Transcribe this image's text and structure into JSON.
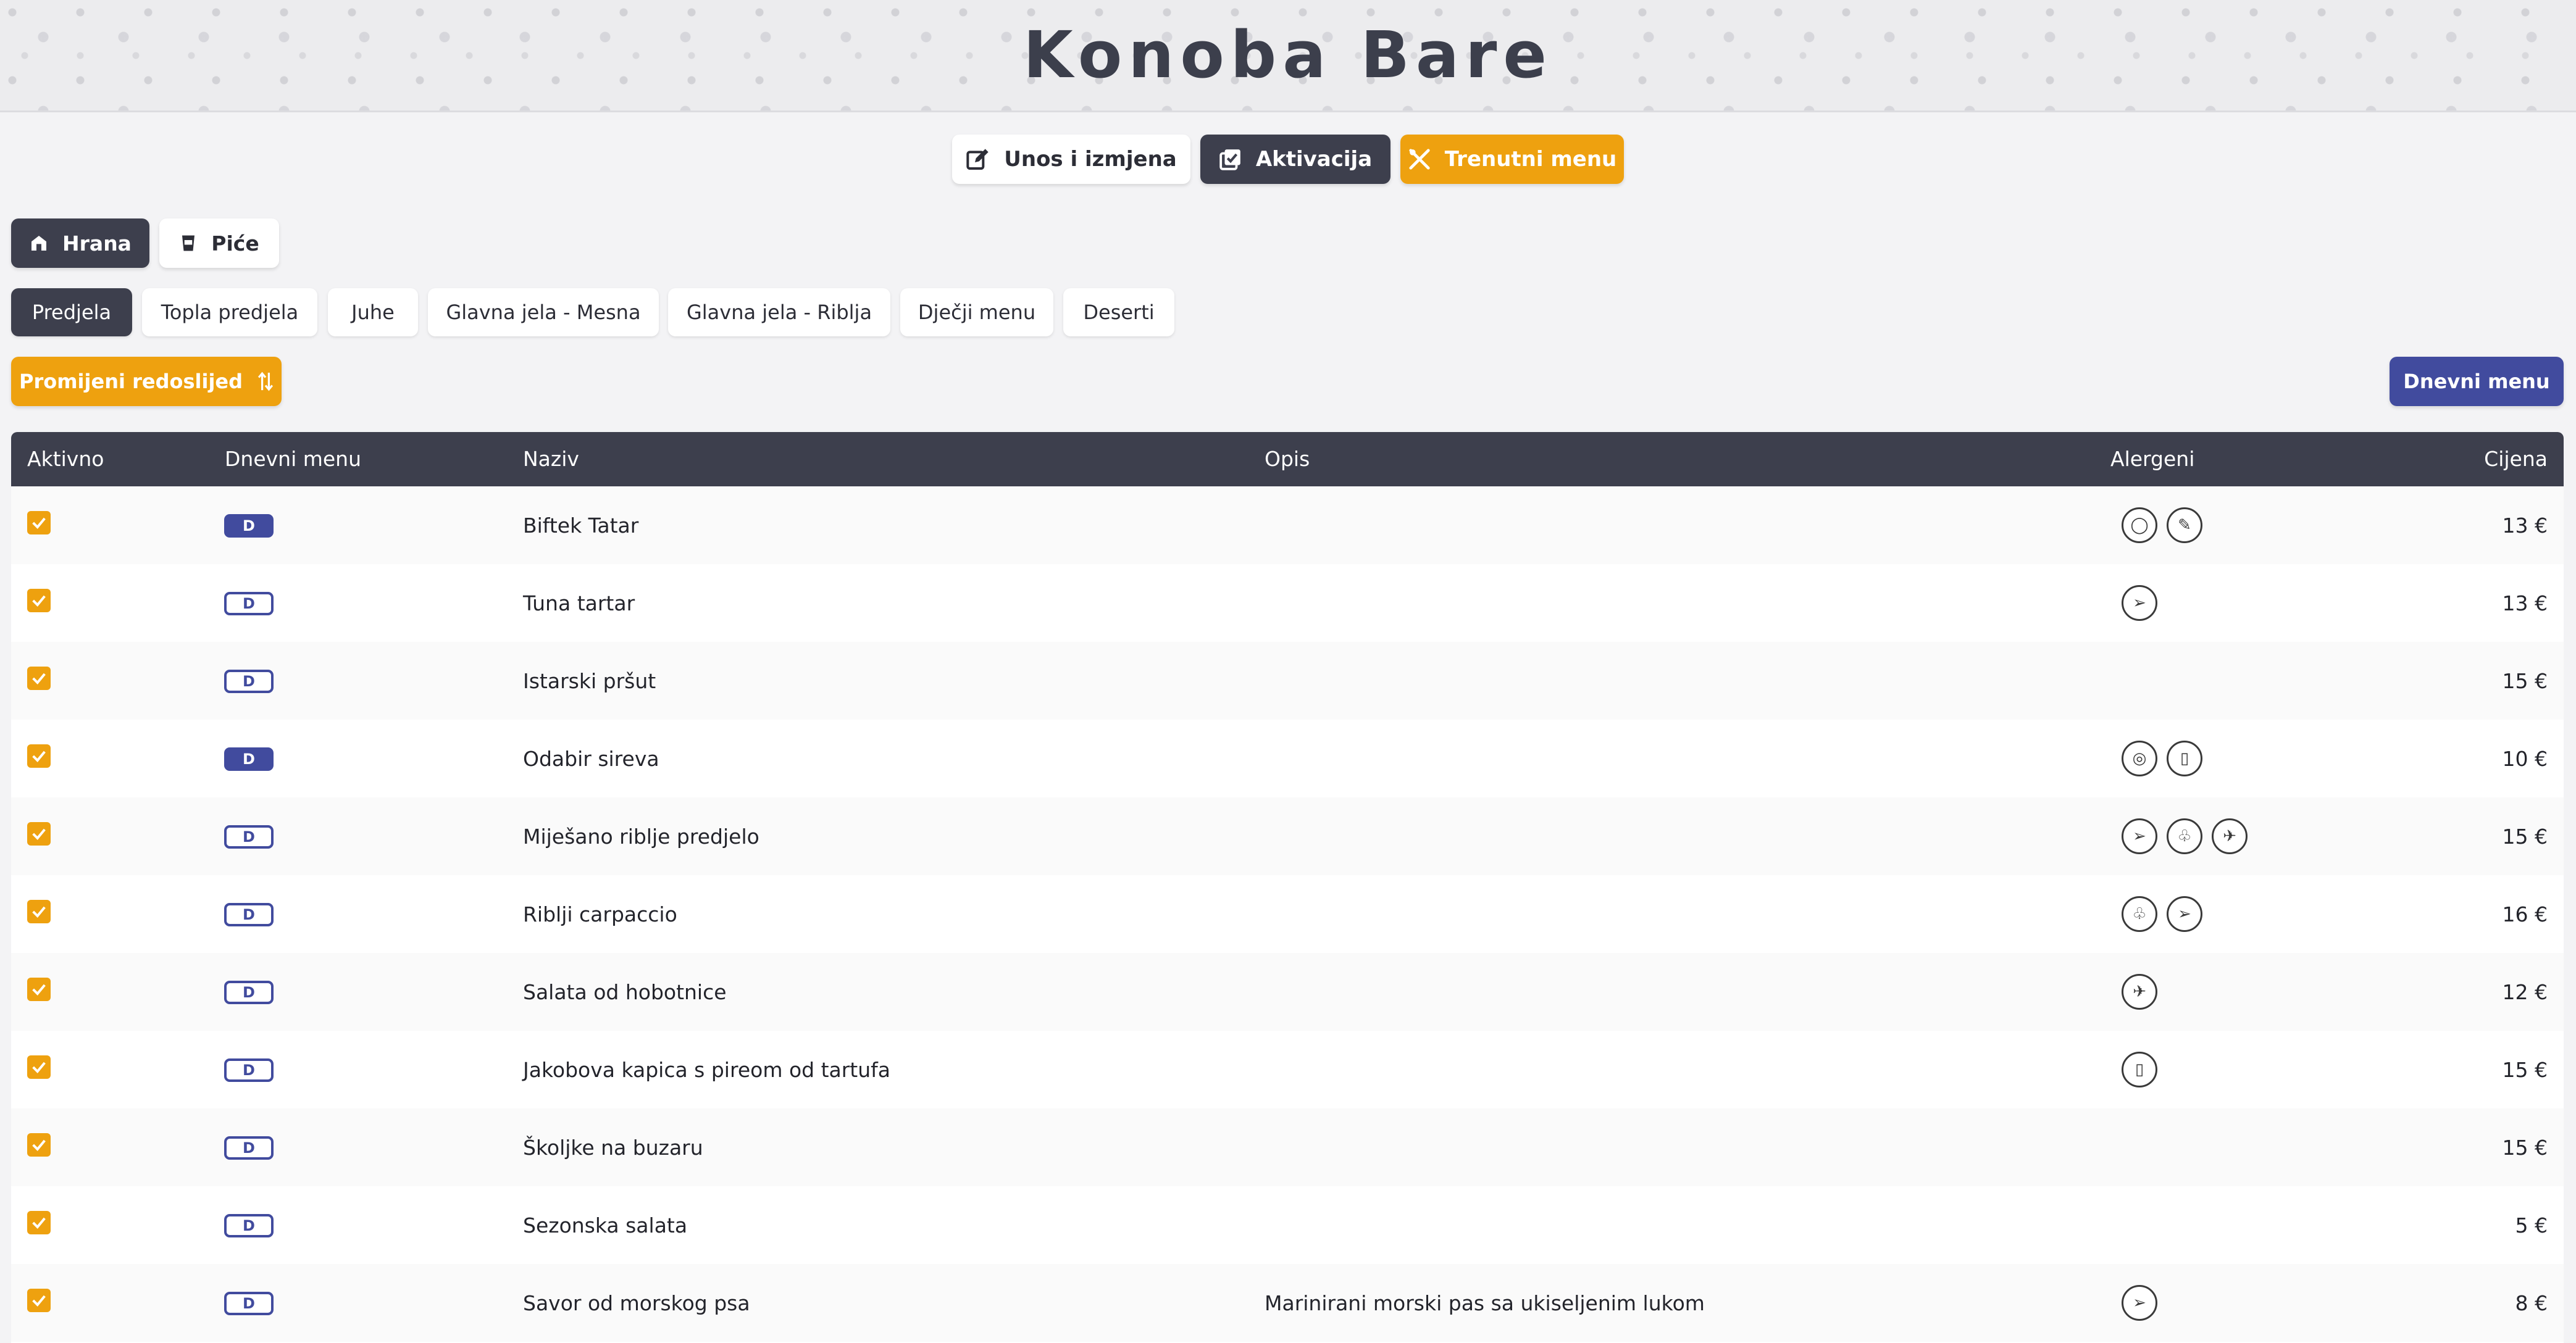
{
  "app": {
    "title": "Konoba Bare"
  },
  "nav": {
    "edit_label": "Unos i izmjena",
    "activation_label": "Aktivacija",
    "current_menu_label": "Trenutni menu"
  },
  "type_tabs": [
    {
      "label": "Hrana",
      "active": true
    },
    {
      "label": "Piće",
      "active": false
    }
  ],
  "category_tabs": [
    {
      "label": "Predjela",
      "active": true
    },
    {
      "label": "Topla predjela",
      "active": false
    },
    {
      "label": "Juhe",
      "active": false
    },
    {
      "label": "Glavna jela - Mesna",
      "active": false
    },
    {
      "label": "Glavna jela - Riblja",
      "active": false
    },
    {
      "label": "Dječji menu",
      "active": false
    },
    {
      "label": "Deserti",
      "active": false
    }
  ],
  "actions": {
    "reorder_label": "Promijeni redoslijed",
    "daily_menu_label": "Dnevni menu"
  },
  "table": {
    "headers": {
      "active": "Aktivno",
      "daily": "Dnevni menu",
      "name": "Naziv",
      "description": "Opis",
      "allergens": "Alergeni",
      "price": "Cijena"
    },
    "daily_badge": "D",
    "rows": [
      {
        "active": true,
        "daily": true,
        "name": "Biftek Tatar",
        "description": "",
        "allergens": [
          "egg-icon",
          "mustard-icon"
        ],
        "price": "13 €"
      },
      {
        "active": true,
        "daily": false,
        "name": "Tuna tartar",
        "description": "",
        "allergens": [
          "fish-icon"
        ],
        "price": "13 €"
      },
      {
        "active": true,
        "daily": false,
        "name": "Istarski pršut",
        "description": "",
        "allergens": [],
        "price": "15 €"
      },
      {
        "active": true,
        "daily": true,
        "name": "Odabir sireva",
        "description": "",
        "allergens": [
          "nuts-icon",
          "milk-icon"
        ],
        "price": "10 €"
      },
      {
        "active": true,
        "daily": false,
        "name": "Miješano riblje predjelo",
        "description": "",
        "allergens": [
          "fish-icon",
          "crustacean-icon",
          "mollusc-icon"
        ],
        "price": "15 €"
      },
      {
        "active": true,
        "daily": false,
        "name": "Riblji carpaccio",
        "description": "",
        "allergens": [
          "crustacean-icon",
          "fish-icon"
        ],
        "price": "16 €"
      },
      {
        "active": true,
        "daily": false,
        "name": "Salata od hobotnice",
        "description": "",
        "allergens": [
          "mollusc-icon"
        ],
        "price": "12 €"
      },
      {
        "active": true,
        "daily": false,
        "name": "Jakobova kapica s pireom od tartufa",
        "description": "",
        "allergens": [
          "milk-icon"
        ],
        "price": "15 €"
      },
      {
        "active": true,
        "daily": false,
        "name": "Školjke na buzaru",
        "description": "",
        "allergens": [],
        "price": "15 €"
      },
      {
        "active": true,
        "daily": false,
        "name": "Sezonska salata",
        "description": "",
        "allergens": [],
        "price": "5 €"
      },
      {
        "active": true,
        "daily": false,
        "name": "Savor od morskog psa",
        "description": "Marinirani morski pas sa ukiseljenim lukom",
        "allergens": [
          "fish-icon"
        ],
        "price": "8 €"
      }
    ]
  },
  "colors": {
    "dark": "#3d3f4d",
    "orange": "#eea10f",
    "blue": "#414b9e"
  }
}
